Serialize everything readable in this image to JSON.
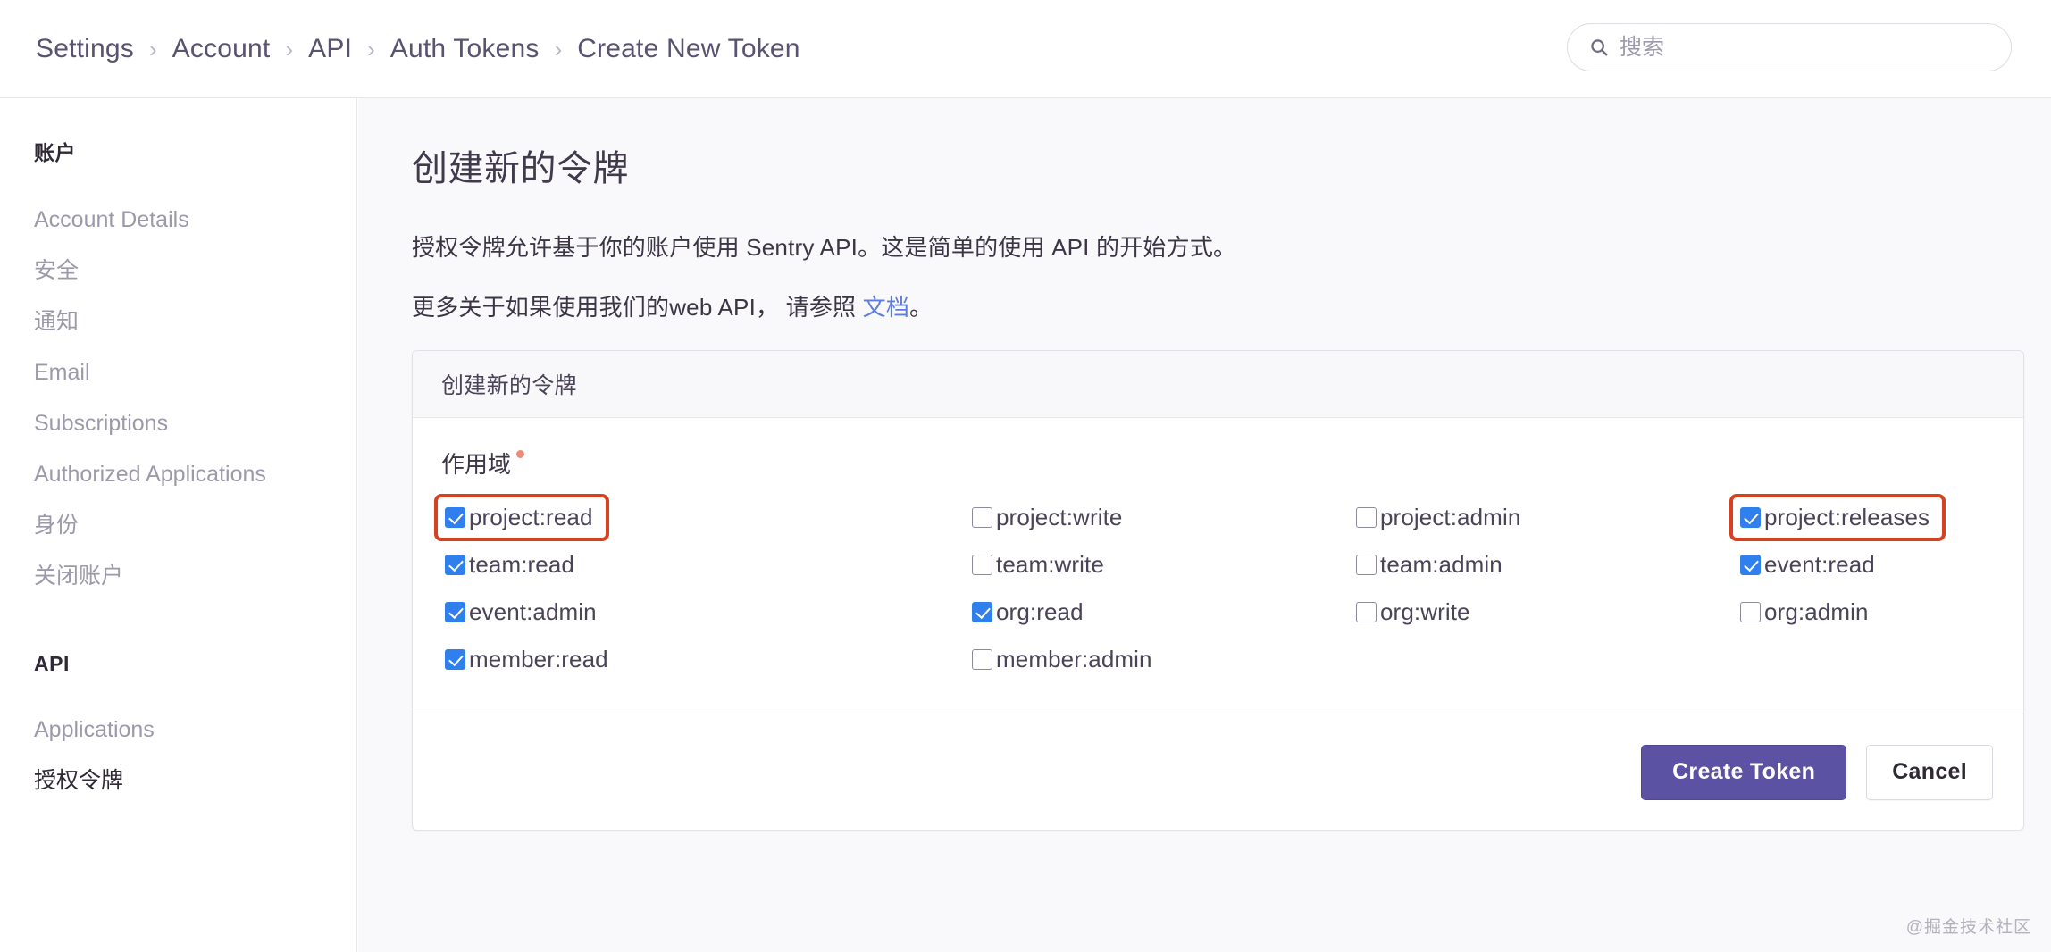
{
  "header": {
    "breadcrumb": [
      {
        "label": "Settings"
      },
      {
        "label": "Account"
      },
      {
        "label": "API"
      },
      {
        "label": "Auth Tokens"
      },
      {
        "label": "Create New Token"
      }
    ],
    "separator": "›",
    "search": {
      "placeholder": "搜索",
      "value": "",
      "icon": "search-icon"
    }
  },
  "sidebar": {
    "groups": [
      {
        "title": "账户",
        "items": [
          {
            "label": "Account Details",
            "active": false
          },
          {
            "label": "安全",
            "active": false
          },
          {
            "label": "通知",
            "active": false
          },
          {
            "label": "Email",
            "active": false
          },
          {
            "label": "Subscriptions",
            "active": false
          },
          {
            "label": "Authorized Applications",
            "active": false
          },
          {
            "label": "身份",
            "active": false
          },
          {
            "label": "关闭账户",
            "active": false
          }
        ]
      },
      {
        "title": "API",
        "items": [
          {
            "label": "Applications",
            "active": false
          },
          {
            "label": "授权令牌",
            "active": true
          }
        ]
      }
    ]
  },
  "main": {
    "page_title": "创建新的令牌",
    "paragraph_1": "授权令牌允许基于你的账户使用 Sentry API。这是简单的使用 API 的开始方式。",
    "paragraph_2_prefix": "更多关于如果使用我们的web API， 请参照 ",
    "paragraph_2_link": "文档",
    "paragraph_2_suffix": "。",
    "panel": {
      "header_title": "创建新的令牌",
      "field_label": "作用域",
      "required_marker": true,
      "scopes": [
        {
          "label": "project:read",
          "checked": true,
          "highlight": true,
          "col": 1,
          "row": 1
        },
        {
          "label": "project:write",
          "checked": false,
          "highlight": false,
          "col": 2,
          "row": 1
        },
        {
          "label": "project:admin",
          "checked": false,
          "highlight": false,
          "col": 3,
          "row": 1
        },
        {
          "label": "project:releases",
          "checked": true,
          "highlight": true,
          "col": 4,
          "row": 1
        },
        {
          "label": "team:read",
          "checked": true,
          "highlight": false,
          "col": 1,
          "row": 2
        },
        {
          "label": "team:write",
          "checked": false,
          "highlight": false,
          "col": 2,
          "row": 2
        },
        {
          "label": "team:admin",
          "checked": false,
          "highlight": false,
          "col": 3,
          "row": 2
        },
        {
          "label": "event:read",
          "checked": true,
          "highlight": false,
          "col": 4,
          "row": 2
        },
        {
          "label": "event:admin",
          "checked": true,
          "highlight": false,
          "col": 1,
          "row": 3
        },
        {
          "label": "org:read",
          "checked": true,
          "highlight": false,
          "col": 2,
          "row": 3
        },
        {
          "label": "org:write",
          "checked": false,
          "highlight": false,
          "col": 3,
          "row": 3
        },
        {
          "label": "org:admin",
          "checked": false,
          "highlight": false,
          "col": 4,
          "row": 3
        },
        {
          "label": "member:read",
          "checked": true,
          "highlight": false,
          "col": 1,
          "row": 4
        },
        {
          "label": "member:admin",
          "checked": false,
          "highlight": false,
          "col": 2,
          "row": 4
        }
      ],
      "footer": {
        "submit_label": "Create Token",
        "cancel_label": "Cancel"
      }
    }
  },
  "watermark": "@掘金技术社区",
  "colors": {
    "primary_button": "#5b52a3",
    "highlight_border": "#d9401f",
    "checkbox_checked": "#2f80ed",
    "link": "#5e7ce0",
    "required_dot": "#ec8a7a",
    "content_background": "#f9f9fb",
    "sidebar_active_text": "#2f2936",
    "sidebar_text": "#9d99ab"
  }
}
